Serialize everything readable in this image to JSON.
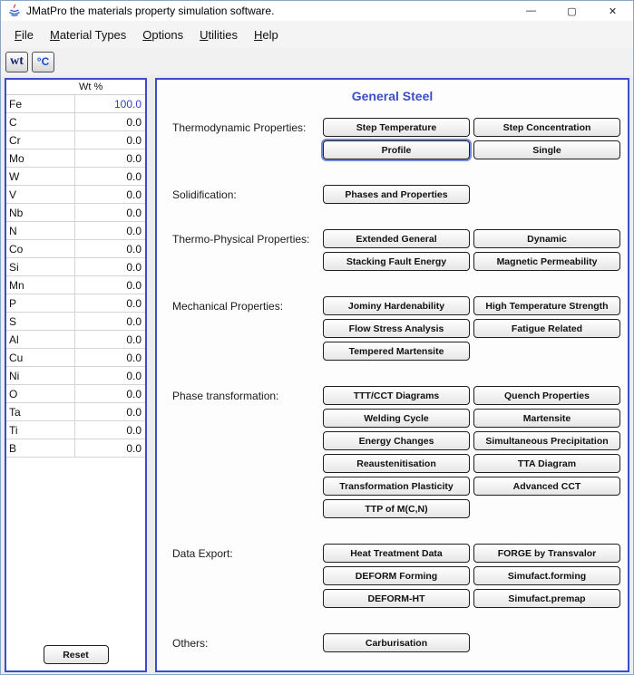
{
  "window": {
    "title": "JMatPro the materials property simulation software.",
    "minimize": "—",
    "maximize": "▢",
    "close": "✕"
  },
  "menu": [
    "File",
    "Material Types",
    "Options",
    "Utilities",
    "Help"
  ],
  "toolbar": {
    "wt": "wt",
    "celsius": "°C"
  },
  "composition": {
    "header": "Wt %",
    "reset": "Reset",
    "highlight_color": "#2f3fd3",
    "rows": [
      {
        "element": "Fe",
        "value": "100.0",
        "highlight": true
      },
      {
        "element": "C",
        "value": "0.0"
      },
      {
        "element": "Cr",
        "value": "0.0"
      },
      {
        "element": "Mo",
        "value": "0.0"
      },
      {
        "element": "W",
        "value": "0.0"
      },
      {
        "element": "V",
        "value": "0.0"
      },
      {
        "element": "Nb",
        "value": "0.0"
      },
      {
        "element": "N",
        "value": "0.0"
      },
      {
        "element": "Co",
        "value": "0.0"
      },
      {
        "element": "Si",
        "value": "0.0"
      },
      {
        "element": "Mn",
        "value": "0.0"
      },
      {
        "element": "P",
        "value": "0.0"
      },
      {
        "element": "S",
        "value": "0.0"
      },
      {
        "element": "Al",
        "value": "0.0"
      },
      {
        "element": "Cu",
        "value": "0.0"
      },
      {
        "element": "Ni",
        "value": "0.0"
      },
      {
        "element": "O",
        "value": "0.0"
      },
      {
        "element": "Ta",
        "value": "0.0"
      },
      {
        "element": "Ti",
        "value": "0.0"
      },
      {
        "element": "B",
        "value": "0.0"
      }
    ]
  },
  "panel": {
    "title": "General Steel",
    "accent": "#3b4ec9",
    "sections": [
      {
        "label": "Thermodynamic Properties:",
        "buttons": [
          {
            "label": "Step Temperature"
          },
          {
            "label": "Step Concentration"
          },
          {
            "label": "Profile",
            "focused": true
          },
          {
            "label": "Single"
          }
        ]
      },
      {
        "label": "Solidification:",
        "buttons": [
          {
            "label": "Phases and Properties"
          }
        ]
      },
      {
        "label": "Thermo-Physical Properties:",
        "buttons": [
          {
            "label": "Extended General"
          },
          {
            "label": "Dynamic"
          },
          {
            "label": "Stacking Fault Energy"
          },
          {
            "label": "Magnetic Permeability"
          }
        ]
      },
      {
        "label": "Mechanical Properties:",
        "buttons": [
          {
            "label": "Jominy Hardenability"
          },
          {
            "label": "High Temperature Strength"
          },
          {
            "label": "Flow Stress Analysis"
          },
          {
            "label": "Fatigue Related"
          },
          {
            "label": "Tempered Martensite"
          }
        ]
      },
      {
        "label": "Phase transformation:",
        "buttons": [
          {
            "label": "TTT/CCT Diagrams"
          },
          {
            "label": "Quench Properties"
          },
          {
            "label": "Welding Cycle"
          },
          {
            "label": "Martensite"
          },
          {
            "label": "Energy Changes"
          },
          {
            "label": "Simultaneous Precipitation"
          },
          {
            "label": "Reaustenitisation"
          },
          {
            "label": "TTA Diagram"
          },
          {
            "label": "Transformation Plasticity"
          },
          {
            "label": "Advanced CCT"
          },
          {
            "label": "TTP of M(C,N)"
          }
        ]
      },
      {
        "label": "Data Export:",
        "buttons": [
          {
            "label": "Heat Treatment Data"
          },
          {
            "label": "FORGE by Transvalor"
          },
          {
            "label": "DEFORM Forming"
          },
          {
            "label": "Simufact.forming"
          },
          {
            "label": "DEFORM-HT"
          },
          {
            "label": "Simufact.premap"
          }
        ]
      },
      {
        "label": "Others:",
        "buttons": [
          {
            "label": "Carburisation"
          }
        ]
      }
    ]
  }
}
